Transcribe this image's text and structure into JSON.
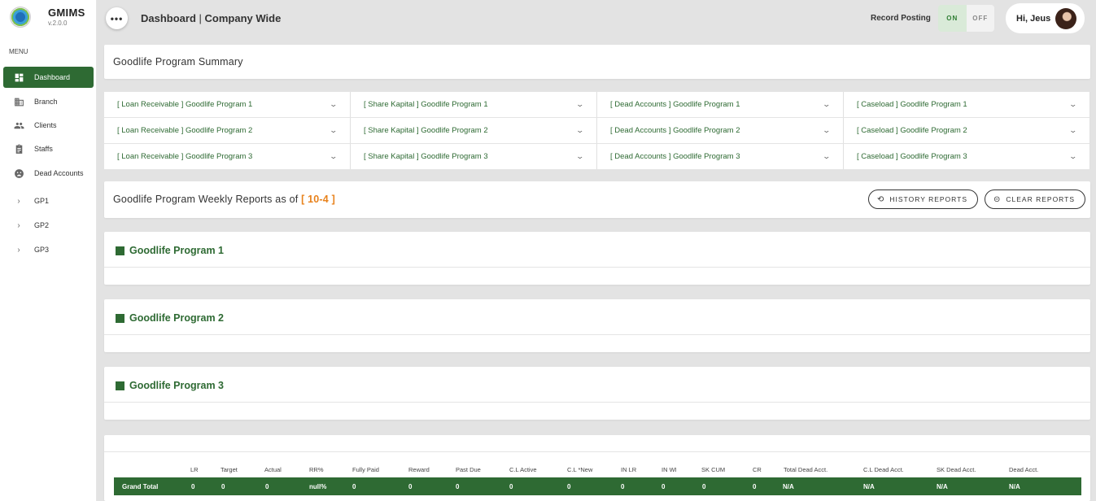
{
  "brand": {
    "name": "GMIMS",
    "version": "v.2.0.0"
  },
  "menu_label": "MENU",
  "nav": [
    {
      "label": "Dashboard",
      "icon": "dashboard-icon"
    },
    {
      "label": "Branch",
      "icon": "building-icon"
    },
    {
      "label": "Clients",
      "icon": "people-icon"
    },
    {
      "label": "Staffs",
      "icon": "clipboard-icon"
    },
    {
      "label": "Dead Accounts",
      "icon": "sad-face-icon"
    },
    {
      "label": "GP1",
      "icon": "chevron-right-icon"
    },
    {
      "label": "GP2",
      "icon": "chevron-right-icon"
    },
    {
      "label": "GP3",
      "icon": "chevron-right-icon"
    }
  ],
  "header": {
    "more": "•••",
    "title_main": "Dashboard",
    "title_sep": " | ",
    "title_sub": "Company Wide",
    "record_posting": "Record Posting",
    "toggle_on": "ON",
    "toggle_off": "OFF",
    "greeting": "Hi, Jeus"
  },
  "summary": {
    "title": "Goodlife Program Summary",
    "cells": [
      "[ Loan Receivable ] Goodlife Program 1",
      "[ Share Kapital ] Goodlife Program 1",
      "[ Dead Accounts ] Goodlife Program 1",
      "[ Caseload ] Goodlife Program 1",
      "[ Loan Receivable ] Goodlife Program 2",
      "[ Share Kapital ] Goodlife Program 2",
      "[ Dead Accounts ] Goodlife Program 2",
      "[ Caseload ] Goodlife Program 2",
      "[ Loan Receivable ] Goodlife Program 3",
      "[ Share Kapital ] Goodlife Program 3",
      "[ Dead Accounts ] Goodlife Program 3",
      "[ Caseload ] Goodlife Program 3"
    ]
  },
  "weekly": {
    "title": "Goodlife Program Weekly Reports as of ",
    "date": "[ 10-4 ]",
    "history_btn": "HISTORY REPORTS",
    "clear_btn": "CLEAR REPORTS"
  },
  "programs": [
    "Goodlife Program 1",
    "Goodlife Program 2",
    "Goodlife Program 3"
  ],
  "totals": {
    "headers": [
      "LR",
      "Target",
      "Actual",
      "RR%",
      "Fully Paid",
      "Reward",
      "Past Due",
      "C.L Active",
      "C.L *New",
      "IN LR",
      "IN WI",
      "SK CUM",
      "CR",
      "Total Dead Acct.",
      "C.L Dead Acct.",
      "SK Dead Acct.",
      "Dead Acct."
    ],
    "row_label": "Grand Total",
    "values": [
      "0",
      "0",
      "0",
      "null%",
      "0",
      "0",
      "0",
      "0",
      "0",
      "0",
      "0",
      "0",
      "0",
      "N/A",
      "N/A",
      "N/A",
      "N/A"
    ]
  },
  "colors": {
    "accent": "#2e6a33",
    "date_accent": "#e8821c"
  }
}
